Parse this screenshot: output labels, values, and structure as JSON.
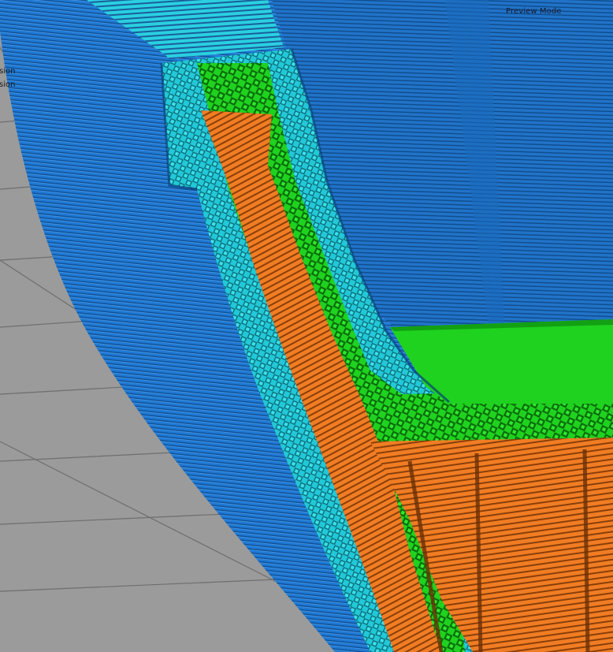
{
  "viewport": {
    "mode_label": "Preview Mode",
    "left_panel_labels": [
      "sion",
      "sion"
    ]
  },
  "colors": {
    "background": "#9b9b9b",
    "grid_line": "#6e6e6e",
    "wall_outer": "#1f78d1",
    "wall_outer_dark": "#0d4f96",
    "wall_inner": "#22c8d8",
    "wall_inner_dark": "#0b6e78",
    "skin": "#1fd21f",
    "skin_dark": "#0a6a0a",
    "infill": "#f07d24",
    "infill_dark": "#8a3e08"
  },
  "legend_icons": [
    "wall-outer-layers",
    "wall-inner-layers",
    "skin-layers",
    "infill-layers"
  ]
}
